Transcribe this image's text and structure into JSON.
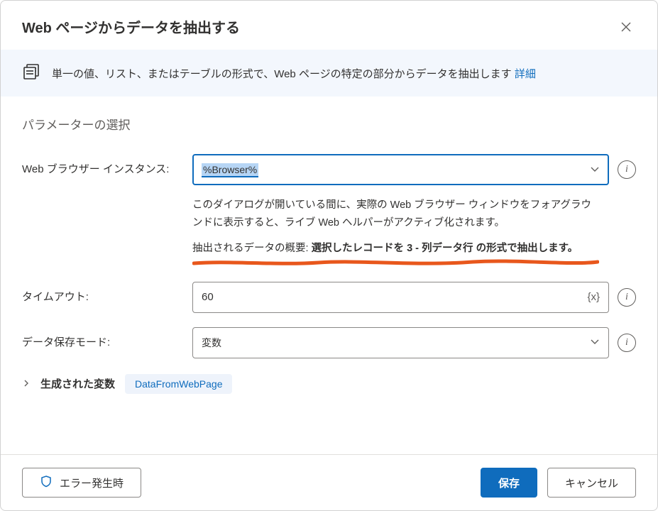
{
  "header": {
    "title": "Web ページからデータを抽出する"
  },
  "banner": {
    "text": "単一の値、リスト、またはテーブルの形式で、Web ページの特定の部分からデータを抽出します",
    "link_label": "詳細"
  },
  "section_title": "パラメーターの選択",
  "fields": {
    "browser": {
      "label": "Web ブラウザー インスタンス:",
      "value": "%Browser%"
    },
    "help": {
      "line1": "このダイアログが開いている間に、実際の Web ブラウザー ウィンドウをフォアグラウンドに表示すると、ライブ Web ヘルパーがアクティブ化されます。",
      "summary_label": "抽出されるデータの概要:",
      "summary_value": "選択したレコードを 3 - 列データ行 の形式で抽出します。"
    },
    "timeout": {
      "label": "タイムアウト:",
      "value": "60",
      "token": "{x}"
    },
    "store": {
      "label": "データ保存モード:",
      "value": "変数"
    }
  },
  "generated_vars": {
    "label": "生成された変数",
    "badge": "DataFromWebPage"
  },
  "footer": {
    "on_error": "エラー発生時",
    "save": "保存",
    "cancel": "キャンセル"
  }
}
